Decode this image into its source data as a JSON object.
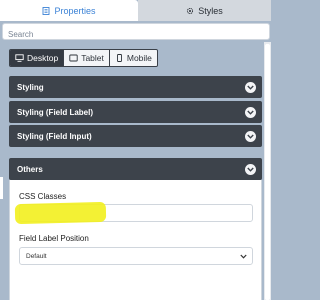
{
  "tabs": {
    "properties_label": "Properties",
    "styles_label": "Styles"
  },
  "search": {
    "placeholder": "Search",
    "value": ""
  },
  "device_toggle": {
    "items": [
      {
        "label": "Desktop",
        "icon": "desktop-icon",
        "active": true
      },
      {
        "label": "Tablet",
        "icon": "tablet-icon",
        "active": false
      },
      {
        "label": "Mobile",
        "icon": "mobile-icon",
        "active": false
      }
    ]
  },
  "sections": [
    {
      "label": "Styling",
      "expanded": false
    },
    {
      "label": "Styling (Field Label)",
      "expanded": false
    },
    {
      "label": "Styling (Field Input)",
      "expanded": false
    },
    {
      "label": "Others",
      "expanded": true
    }
  ],
  "others_panel": {
    "css_classes_label": "CSS Classes",
    "css_classes_value": "",
    "field_label_position_label": "Field Label Position",
    "field_label_position_value": "Default"
  },
  "colors": {
    "accent": "#3b82d6",
    "header_dark": "#3d434b",
    "background": "#a9b9cb",
    "highlight": "#f2f01e"
  }
}
